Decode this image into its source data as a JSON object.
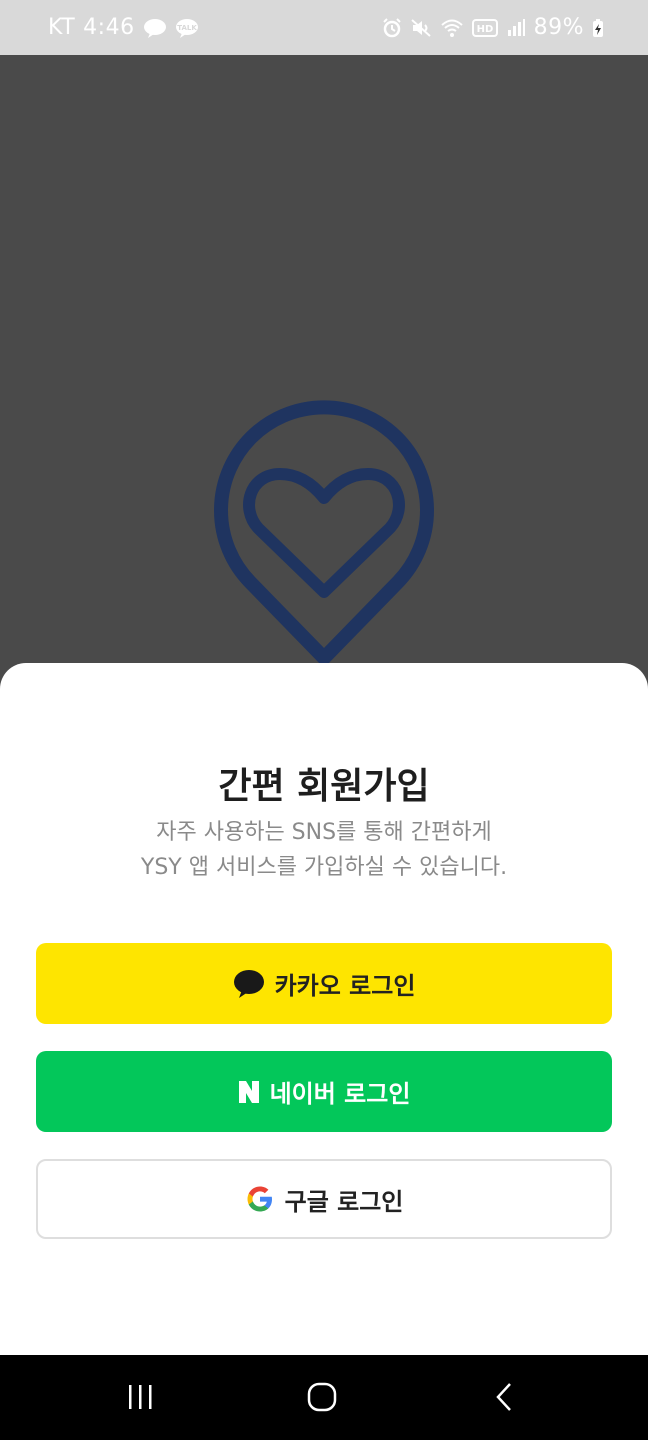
{
  "status_bar": {
    "carrier": "KT",
    "time": "4:46",
    "battery": "89%",
    "icons": [
      "chat-bubble-icon",
      "talk-icon",
      "alarm-icon",
      "mute-icon",
      "wifi-icon",
      "hd-icon",
      "signal-icon",
      "battery-charging-icon"
    ]
  },
  "app": {
    "logo": "location-pin-heart-icon",
    "logo_color": "#1f3460",
    "background_color": "#4a4a4a"
  },
  "sheet": {
    "title": "간편 회원가입",
    "description_line1": "자주 사용하는 SNS를 통해 간편하게",
    "description_line2": "YSY 앱 서비스를 가입하실 수 있습니다.",
    "buttons": {
      "kakao": {
        "label": "카카오 로그인",
        "icon": "kakao-speech-bubble-icon",
        "color": "#fee500"
      },
      "naver": {
        "label": "네이버 로그인",
        "icon": "naver-n-icon",
        "color": "#03c75a"
      },
      "google": {
        "label": "구글 로그인",
        "icon": "google-g-icon",
        "color": "#ffffff"
      }
    }
  },
  "nav_bar": {
    "items": [
      "recent-apps-icon",
      "home-icon",
      "back-icon"
    ]
  }
}
